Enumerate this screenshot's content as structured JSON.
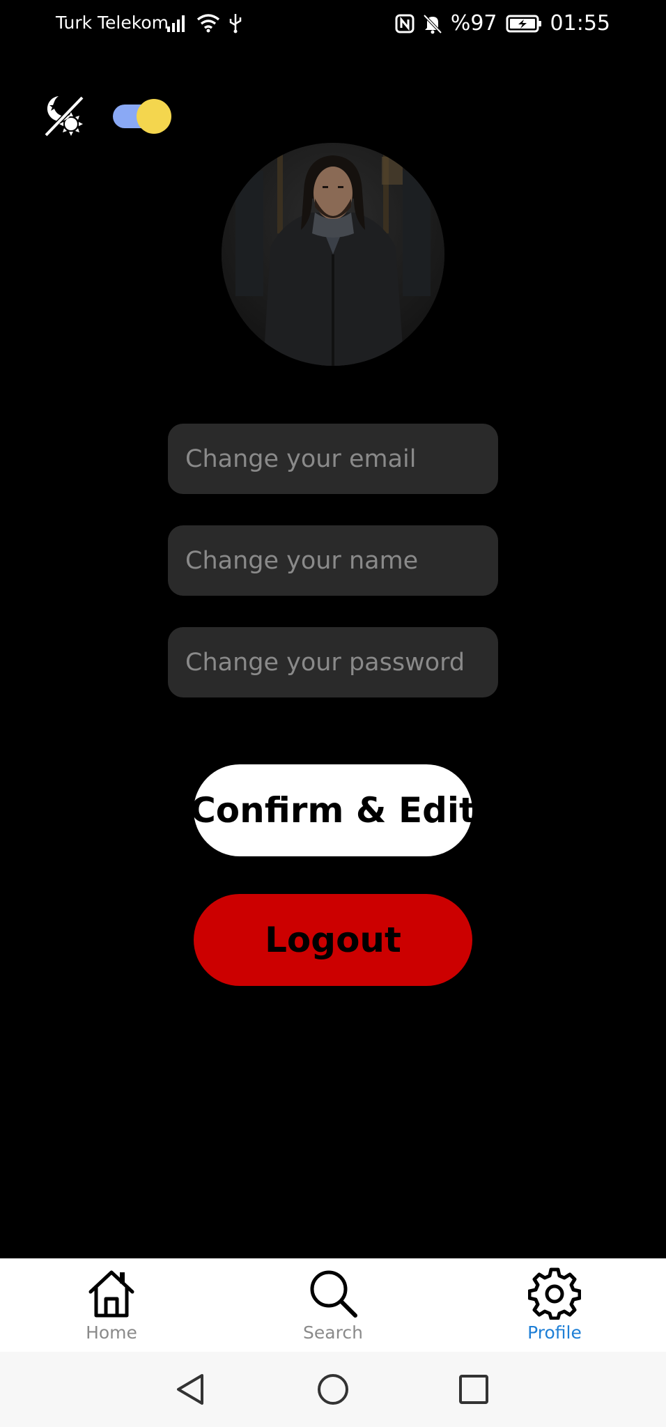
{
  "status_bar": {
    "carrier": "Turk Telekom",
    "battery": "%97",
    "time": "01:55",
    "icons_left": [
      "signal-icon",
      "wifi-icon",
      "usb-icon"
    ],
    "icons_right": [
      "nfc-icon",
      "bell-off-icon",
      "battery-charging-icon"
    ]
  },
  "theme": {
    "icon": "moon-sun-icon",
    "toggle_on": true,
    "track_color": "#8aa9f5",
    "knob_color": "#f4d64e"
  },
  "profile": {
    "avatar": "avatar"
  },
  "form": {
    "email_placeholder": "Change your email",
    "name_placeholder": "Change your name",
    "password_placeholder": "Change your password",
    "email_value": "",
    "name_value": "",
    "password_value": ""
  },
  "buttons": {
    "confirm_label": "Confirm & Edit",
    "logout_label": "Logout",
    "confirm_color": "#ffffff",
    "logout_color": "#cc0000"
  },
  "bottom_nav": {
    "items": [
      {
        "label": "Home",
        "icon": "home-icon",
        "active": false
      },
      {
        "label": "Search",
        "icon": "search-icon",
        "active": false
      },
      {
        "label": "Profile",
        "icon": "gear-icon",
        "active": true
      }
    ],
    "active_color": "#1e7fd6",
    "inactive_color": "#8a8a8a"
  },
  "system_nav": {
    "buttons": [
      "back-icon",
      "home-circle-icon",
      "recents-icon"
    ]
  }
}
